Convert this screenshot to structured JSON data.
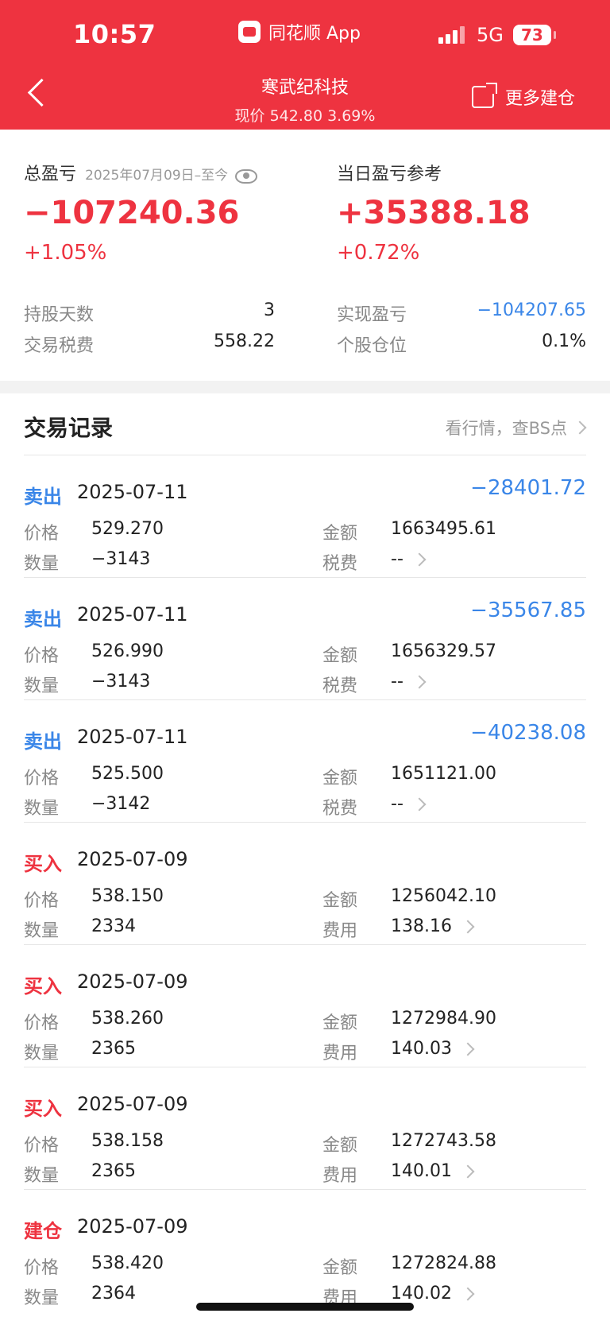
{
  "status_bar": {
    "time": "10:57",
    "app_label": "同花顺 App",
    "network": "5G",
    "battery": "73"
  },
  "header": {
    "title": "寒武纪科技",
    "subtitle": "现价 542.80 3.69%",
    "more_label": "更多建仓"
  },
  "summary": {
    "total_label": "总盈亏",
    "total_date_range": "2025年07月09日–至今",
    "total_value": "−107240.36",
    "total_pct": "+1.05%",
    "daily_label": "当日盈亏参考",
    "daily_value": "+35388.18",
    "daily_pct": "+0.72%",
    "left_kv": [
      {
        "label": "持股天数",
        "value": "3"
      },
      {
        "label": "交易税费",
        "value": "558.22"
      }
    ],
    "right_kv": [
      {
        "label": "实现盈亏",
        "value": "−104207.65"
      },
      {
        "label": "个股仓位",
        "value": "0.1%"
      }
    ]
  },
  "records": {
    "title": "交易记录",
    "link": "看行情，查BS点",
    "items": [
      {
        "type": "卖出",
        "kind": "sell",
        "date": "2025-07-11",
        "pl": "−28401.72",
        "price_label": "价格",
        "price": "529.270",
        "qty_label": "数量",
        "qty": "−3143",
        "amount_label": "金额",
        "amount": "1663495.61",
        "fee_label": "税费",
        "fee": "--"
      },
      {
        "type": "卖出",
        "kind": "sell",
        "date": "2025-07-11",
        "pl": "−35567.85",
        "price_label": "价格",
        "price": "526.990",
        "qty_label": "数量",
        "qty": "−3143",
        "amount_label": "金额",
        "amount": "1656329.57",
        "fee_label": "税费",
        "fee": "--"
      },
      {
        "type": "卖出",
        "kind": "sell",
        "date": "2025-07-11",
        "pl": "−40238.08",
        "price_label": "价格",
        "price": "525.500",
        "qty_label": "数量",
        "qty": "−3142",
        "amount_label": "金额",
        "amount": "1651121.00",
        "fee_label": "税费",
        "fee": "--"
      },
      {
        "type": "买入",
        "kind": "buy",
        "date": "2025-07-09",
        "pl": "",
        "price_label": "价格",
        "price": "538.150",
        "qty_label": "数量",
        "qty": "2334",
        "amount_label": "金额",
        "amount": "1256042.10",
        "fee_label": "费用",
        "fee": "138.16"
      },
      {
        "type": "买入",
        "kind": "buy",
        "date": "2025-07-09",
        "pl": "",
        "price_label": "价格",
        "price": "538.260",
        "qty_label": "数量",
        "qty": "2365",
        "amount_label": "金额",
        "amount": "1272984.90",
        "fee_label": "费用",
        "fee": "140.03"
      },
      {
        "type": "买入",
        "kind": "buy",
        "date": "2025-07-09",
        "pl": "",
        "price_label": "价格",
        "price": "538.158",
        "qty_label": "数量",
        "qty": "2365",
        "amount_label": "金额",
        "amount": "1272743.58",
        "fee_label": "费用",
        "fee": "140.01"
      },
      {
        "type": "建仓",
        "kind": "buy",
        "date": "2025-07-09",
        "pl": "",
        "price_label": "价格",
        "price": "538.420",
        "qty_label": "数量",
        "qty": "2364",
        "amount_label": "金额",
        "amount": "1272824.88",
        "fee_label": "费用",
        "fee": "140.02"
      }
    ]
  },
  "colors": {
    "brand_red": "#ee3340",
    "loss_blue": "#3a86e8"
  }
}
